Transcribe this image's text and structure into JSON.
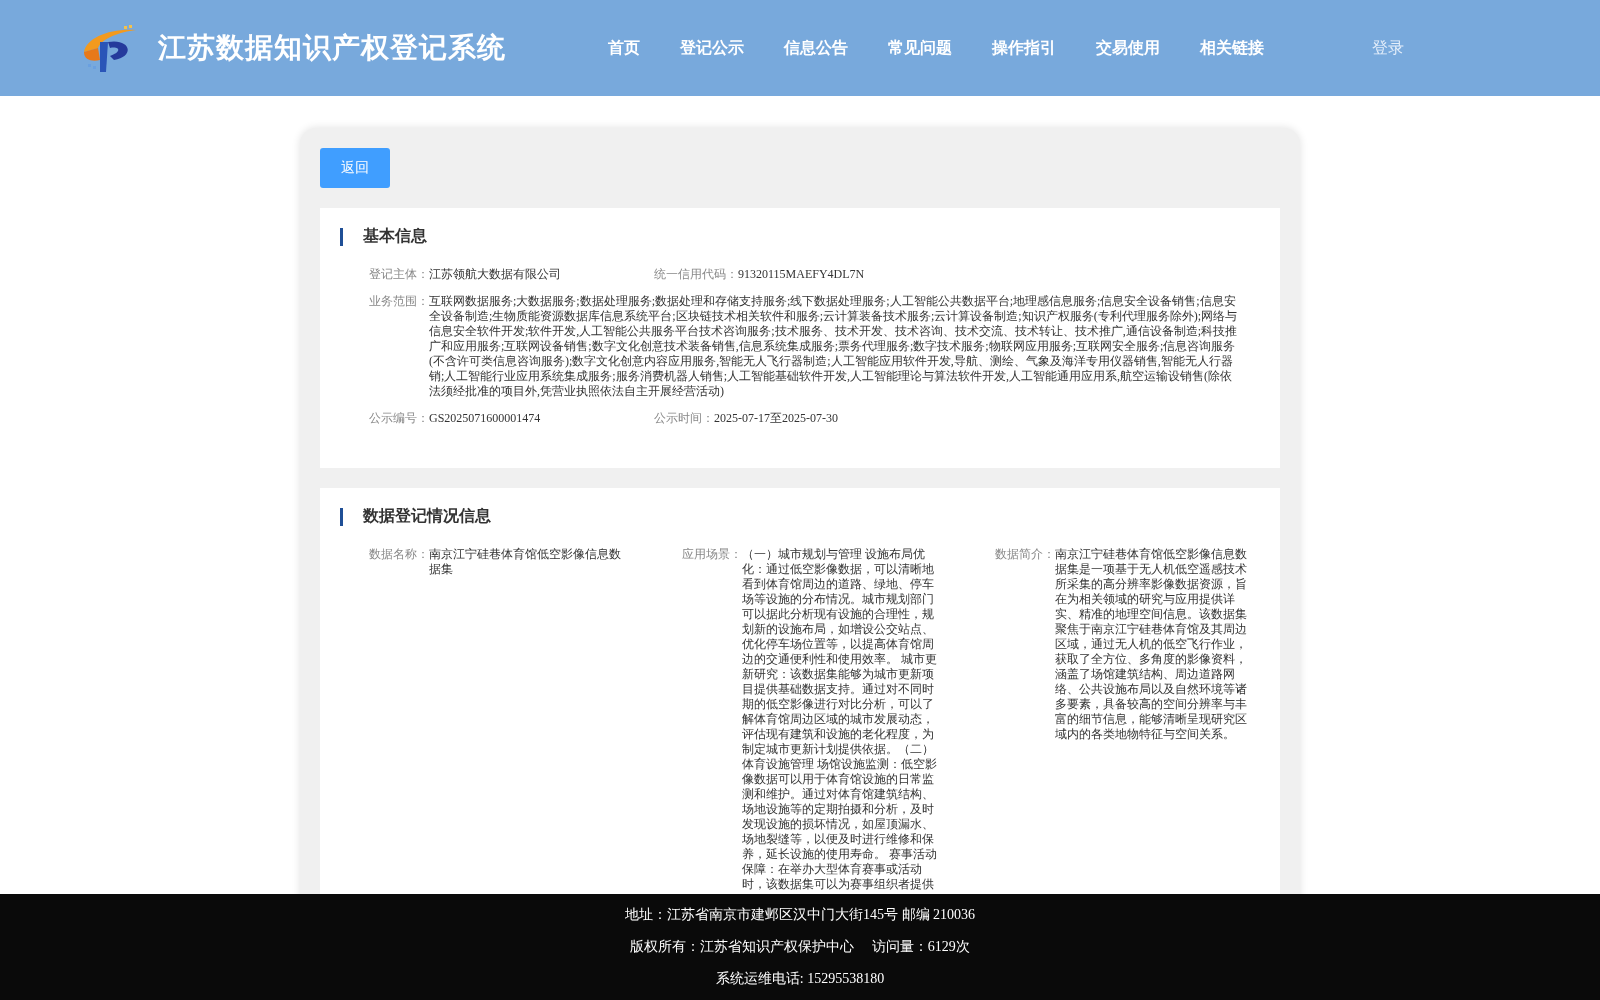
{
  "header": {
    "title": "江苏数据知识产权登记系统",
    "nav": [
      {
        "label": "首页",
        "selected": false
      },
      {
        "label": "登记公示",
        "selected": false
      },
      {
        "label": "信息公告",
        "selected": false
      },
      {
        "label": "常见问题",
        "selected": false
      },
      {
        "label": "操作指引",
        "selected": false
      },
      {
        "label": "交易使用",
        "selected": false
      },
      {
        "label": "相关链接",
        "selected": false
      }
    ],
    "login": "登录"
  },
  "back_button": "返回",
  "basic_info": {
    "title": "基本信息",
    "rows": [
      [
        {
          "label": "登记主体：",
          "value": "江苏领航大数据有限公司"
        },
        {
          "label": "统一信用代码：",
          "value": "91320115MAEFY4DL7N"
        }
      ],
      [
        {
          "label": "业务范围：",
          "value": "互联网数据服务;大数据服务;数据处理服务;数据处理和存储支持服务;线下数据处理服务;人工智能公共数据平台;地理感信息服务;信息安全设备销售;信息安全设备制造;生物质能资源数据库信息系统平台;区块链技术相关软件和服务;云计算装备技术服务;云计算设备制造;知识产权服务(专利代理服务除外);网络与信息安全软件开发;软件开发,人工智能公共服务平台技术咨询服务;技术服务、技术开发、技术咨询、技术交流、技术转让、技术推广,通信设备制造;科技推广和应用服务;互联网设备销售;数字文化创意技术装备销售,信息系统集成服务;票务代理服务;数字技术服务;物联网应用服务;互联网安全服务;信息咨询服务(不含许可类信息咨询服务);数字文化创意内容应用服务,智能无人飞行器制造;人工智能应用软件开发,导航、测绘、气象及海洋专用仪器销售,智能无人行器销;人工智能行业应用系统集成服务;服务消费机器人销售;人工智能基础软件开发,人工智能理论与算法软件开发,人工智能通用应用系,航空运输设销售(除依法须经批准的项目外,凭营业执照依法自主开展经营活动)"
        }
      ],
      [
        {
          "label": "公示编号：",
          "value": "GS2025071600001474"
        },
        {
          "label": "公示时间：",
          "value": "2025-07-17至2025-07-30"
        }
      ]
    ]
  },
  "registration_info": {
    "title": "数据登记情况信息",
    "fields": [
      {
        "label": "数据名称：",
        "value": "南京江宁硅巷体育馆低空影像信息数据集"
      },
      {
        "label": "应用场景：",
        "value": "（一）城市规划与管理 设施布局优化：通过低空影像数据，可以清晰地看到体育馆周边的道路、绿地、停车场等设施的分布情况。城市规划部门可以据此分析现有设施的合理性，规划新的设施布局，如增设公交站点、优化停车场位置等，以提高体育馆周边的交通便利性和使用效率。 城市更新研究：该数据集能够为城市更新项目提供基础数据支持。通过对不同时期的低空影像进行对比分析，可以了解体育馆周边区域的城市发展动态，评估现有建筑和设施的老化程度，为制定城市更新计划提供依据。（二）体育设施管理 场馆设施监测：低空影像数据可以用于体育馆设施的日常监测和维护。通过对体育馆建筑结构、场地设施等的定期拍摄和分析，及时发现设施的损坏情况，如屋顶漏水、场地裂缝等，以便及时进行维修和保养，延长设施的使用寿命。 赛事活动保障：在举办大型体育赛事或活动时，该数据集可以为赛事组织者提供"
      },
      {
        "label": "数据简介：",
        "value": "南京江宁硅巷体育馆低空影像信息数据集是一项基于无人机低空遥感技术所采集的高分辨率影像数据资源，旨在为相关领域的研究与应用提供详实、精准的地理空间信息。该数据集聚焦于南京江宁硅巷体育馆及其周边区域，通过无人机的低空飞行作业，获取了全方位、多角度的影像资料，涵盖了场馆建筑结构、周边道路网络、公共设施布局以及自然环境等诸多要素，具备较高的空间分辨率与丰富的细节信息，能够清晰呈现研究区域内的各类地物特征与空间关系。"
      }
    ]
  },
  "footer": [
    "地址：江苏省南京市建邺区汉中门大街145号 邮编 210036",
    "版权所有：江苏省知识产权保护中心　 访问量：6129次",
    "系统运维电话: 15295538180"
  ]
}
